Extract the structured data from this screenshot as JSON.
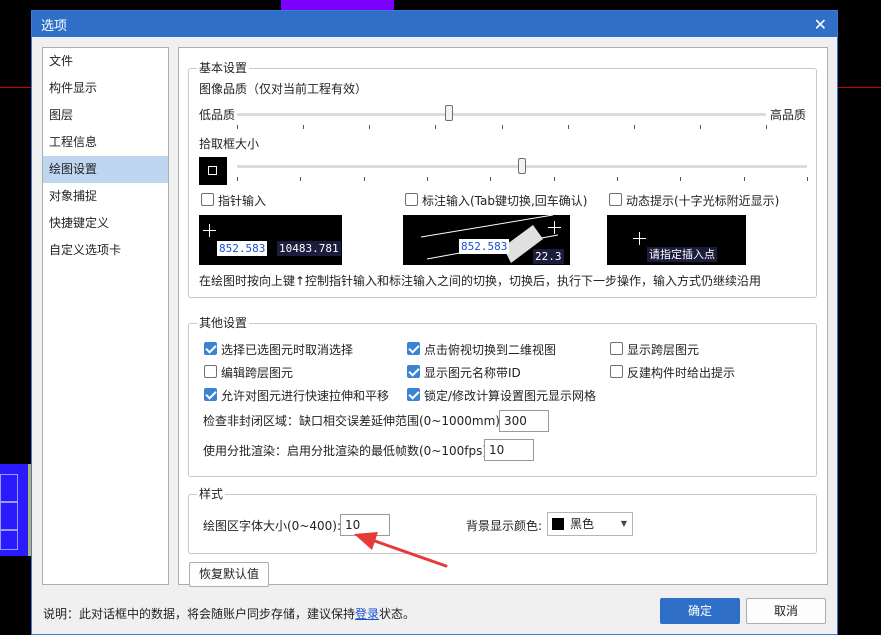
{
  "window": {
    "title": "选项",
    "close_glyph": "✕"
  },
  "nav": {
    "items": [
      "文件",
      "构件显示",
      "图层",
      "工程信息",
      "绘图设置",
      "对象捕捉",
      "快捷键定义",
      "自定义选项卡"
    ],
    "active_index": 4
  },
  "basic": {
    "title": "基本设置",
    "image_quality_label": "图像品质（仅对当前工程有效）",
    "low_label": "低品质",
    "high_label": "高品质",
    "image_quality_level": 0.4,
    "pick_box_label": "拾取框大小",
    "pick_box_level": 0.5,
    "pointer_input": "指针输入",
    "dimension_input": "标注输入(Tab键切换,回车确认)",
    "dynamic_tip": "动态提示(十字光标附近显示)",
    "pointer_input_checked": false,
    "dimension_input_checked": false,
    "dynamic_tip_checked": false,
    "preview1_x": "852.583",
    "preview1_y": "10483.781",
    "preview2_len": "852.583",
    "preview2_angle": "22.3",
    "preview3_prompt": "请指定插入点",
    "description": "在绘图时按向上键↑控制指针输入和标注输入之间的切换，切换后，执行下一步操作，输入方式仍继续沿用"
  },
  "other": {
    "title": "其他设置",
    "options": [
      {
        "label": "选择已选图元时取消选择",
        "checked": true
      },
      {
        "label": "点击俯视切换到二维视图",
        "checked": true
      },
      {
        "label": "显示跨层图元",
        "checked": false
      },
      {
        "label": "编辑跨层图元",
        "checked": false
      },
      {
        "label": "显示图元名称带ID",
        "checked": true
      },
      {
        "label": "反建构件时给出提示",
        "checked": false
      },
      {
        "label": "允许对图元进行快速拉伸和平移",
        "checked": true
      },
      {
        "label": "锁定/修改计算设置图元显示网格",
        "checked": true
      }
    ],
    "gap_label": "检查非封闭区域：缺口相交误差延伸范围(0~1000mm):",
    "gap_value": "300",
    "batch_label": "使用分批渲染：启用分批渲染的最低帧数(0~100fps):",
    "batch_value": "10"
  },
  "style": {
    "title": "样式",
    "font_size_label": "绘图区字体大小(0~400):",
    "font_size_value": "10",
    "bg_color_label": "背景显示颜色:",
    "bg_color_value": "黑色",
    "bg_color_hex": "#000000"
  },
  "buttons": {
    "restore": "恢复默认值",
    "ok": "确定",
    "cancel": "取消"
  },
  "footer": {
    "prefix": "说明：此对话框中的数据，将会随账户同步存储，建议保持",
    "link": "登录",
    "suffix": "状态。"
  },
  "colors": {
    "accent": "#2f6fc7",
    "annotation_arrow": "#e63a3a"
  }
}
